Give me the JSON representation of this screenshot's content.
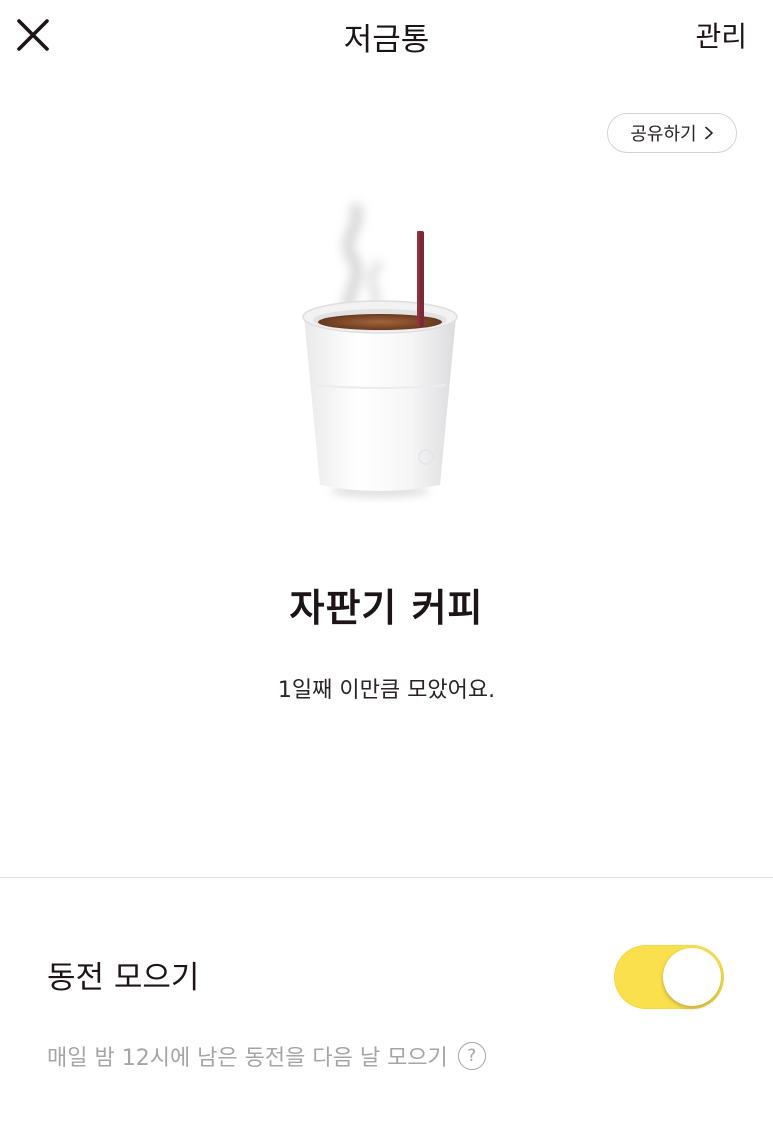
{
  "header": {
    "title": "저금통",
    "close_icon": "close-icon",
    "manage_label": "관리"
  },
  "share": {
    "label": "공유하기",
    "icon": "chevron-right-icon"
  },
  "goal": {
    "title": "자판기 커피",
    "subtitle": "1일째 이만큼 모았어요."
  },
  "coin_collect": {
    "label": "동전 모으기",
    "enabled": true,
    "description": "매일 밤 12시에 남은 동전을 다음 날 모으기",
    "help_symbol": "?"
  },
  "colors": {
    "accent": "#fbe04d",
    "text": "#1c1416",
    "muted": "#a8a3a5"
  }
}
